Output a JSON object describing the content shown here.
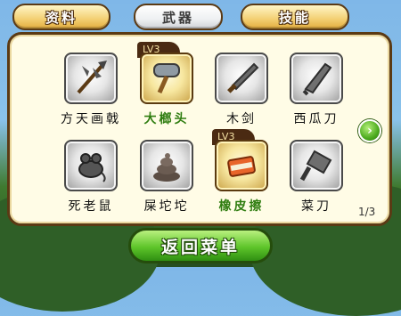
{
  "tabs": [
    {
      "label": "资料",
      "active": false
    },
    {
      "label": "武器",
      "active": true
    },
    {
      "label": "技能",
      "active": false
    }
  ],
  "items": [
    {
      "name": "方天画戟",
      "icon": "halberd-icon",
      "level": null,
      "highlight": false
    },
    {
      "name": "大榔头",
      "icon": "hammer-icon",
      "level": "LV3",
      "highlight": true
    },
    {
      "name": "木剑",
      "icon": "wooden-sword-icon",
      "level": null,
      "highlight": false
    },
    {
      "name": "西瓜刀",
      "icon": "machete-icon",
      "level": null,
      "highlight": false
    },
    {
      "name": "死老鼠",
      "icon": "dead-rat-icon",
      "level": null,
      "highlight": false
    },
    {
      "name": "屎坨坨",
      "icon": "poop-icon",
      "level": null,
      "highlight": false
    },
    {
      "name": "橡皮擦",
      "icon": "eraser-icon",
      "level": "LV3",
      "highlight": true
    },
    {
      "name": "菜刀",
      "icon": "cleaver-icon",
      "level": null,
      "highlight": false
    }
  ],
  "pagination": {
    "text": "1/3"
  },
  "back_button": {
    "label": "返回菜单"
  },
  "colors": {
    "selected_text": "#2f7d10",
    "panel": "#fffce6",
    "button": "#5ec52a"
  }
}
